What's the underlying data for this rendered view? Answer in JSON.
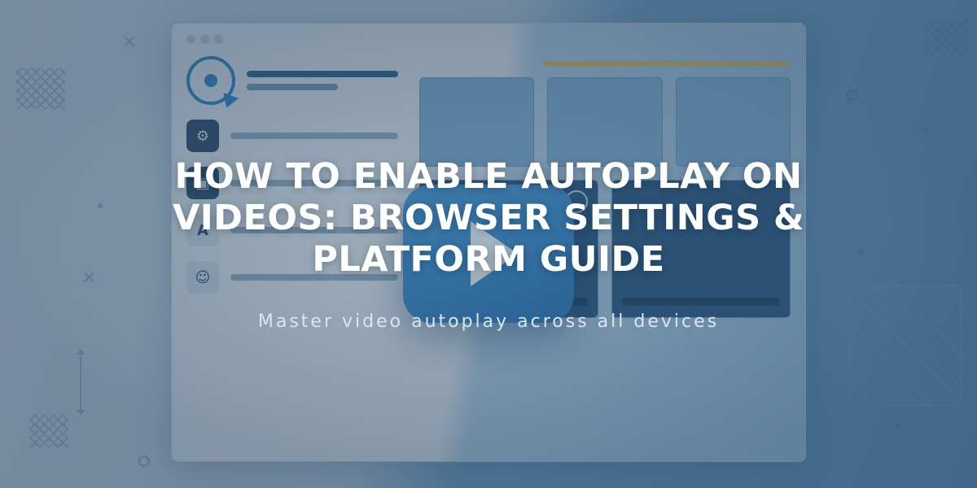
{
  "hero": {
    "title": "HOW TO ENABLE AUTOPLAY ON VIDEOS: BROWSER SETTINGS & PLATFORM GUIDE",
    "subtitle": "Master video autoplay across all devices"
  },
  "icons": {
    "play": "play-icon",
    "target": "target-icon",
    "cursor": "cursor-icon"
  },
  "colors": {
    "overlay_text": "#fdfefe",
    "accent_blue": "#2f88c7",
    "play_gradient_start": "#4aa0de",
    "play_gradient_end": "#2e78b8",
    "yellow_bar": "#e8c24a"
  }
}
